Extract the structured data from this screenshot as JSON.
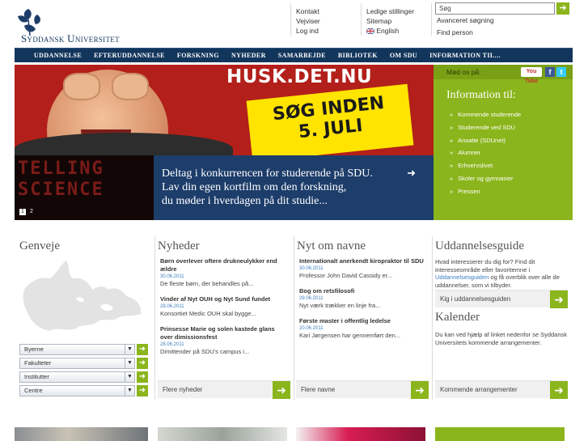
{
  "brand": {
    "name": "Syddansk Universitet"
  },
  "header": {
    "col1": [
      "Kontakt",
      "Vejviser",
      "Log ind"
    ],
    "col2": [
      "Ledige stillinger",
      "Sitemap",
      "English"
    ],
    "search_placeholder": "Søg",
    "advanced_search": "Avanceret søgning",
    "find_person": "Find person"
  },
  "nav": [
    "UDDANNELSE",
    "EFTERUDDANNELSE",
    "FORSKNING",
    "NYHEDER",
    "SAMARBEJDE",
    "BIBLIOTEK",
    "OM SDU",
    "INFORMATION TIL..."
  ],
  "hero": {
    "title": "HUSK.DET.NU",
    "sticker_line1": "SØG INDEN",
    "sticker_line2": "5. JULI",
    "sub_image_text": "TELLING SCIENCE",
    "pager": [
      "1",
      "2"
    ],
    "sub_line1": "Deltag i konkurrencen for studerende på SDU.",
    "sub_line2": "Lav din egen kortfilm om den forskning,",
    "sub_line3": "du møder i hverdagen på dit studie..."
  },
  "side": {
    "meet_label": "Mød os på:",
    "youtube": "You Tube",
    "heading": "Information til:",
    "items": [
      "Kommende studerende",
      "Studerende ved SDU",
      "Ansatte (SDUnet)",
      "Alumner",
      "Erhvervslivet",
      "Skoler og gymnasier",
      "Pressen"
    ]
  },
  "genveje": {
    "title": "Genveje",
    "dropdowns": [
      "Byerne",
      "Fakulteter",
      "Institutter",
      "Centre"
    ]
  },
  "nyheder": {
    "title": "Nyheder",
    "items": [
      {
        "title": "Børn overlever oftere drukneulykker end ældre",
        "date": "30.06.2011",
        "text": "De fleste børn, der behandles på..."
      },
      {
        "title": "Vinder af Nyt OUH og Nyt Sund fundet",
        "date": "28.06.2011",
        "text": "Konsortiet Medic OUH skal bygge..."
      },
      {
        "title": "Prinsesse Marie og solen kastede glans over dimissionsfest",
        "date": "28.06.2011",
        "text": "Dimittender på SDU's campus i..."
      }
    ],
    "more": "Flere nyheder"
  },
  "navne": {
    "title": "Nyt om navne",
    "items": [
      {
        "title": "Internationalt anerkendt kiropraktor til SDU",
        "date": "30.06.2011",
        "text": "Professor John David Cassidy er..."
      },
      {
        "title": "Bog om retsfilosofi",
        "date": "29.06.2011",
        "text": "Nyt værk trækker en linje fra..."
      },
      {
        "title": "Første master i offentlig ledelse",
        "date": "20.06.2011",
        "text": "Kari Jørgensen har gennemført den..."
      }
    ],
    "more": "Flere navne"
  },
  "uddannelsesguide": {
    "title": "Uddannelsesguide",
    "text1": "Hvad interesserer du dig for? Find dit interesseområde eller favoritemne",
    "text2_prefix": "i ",
    "text2_link": "Uddannelsesguiden",
    "text2_suffix": " og få overblik over alle de uddannelser, som vi tilbyder.",
    "field": "Kig i uddannelsesguiden"
  },
  "kalender": {
    "title": "Kalender",
    "text": "Du kan ved hjælp af linket nedenfor se Syddansk Universitets kommende arrangementer.",
    "more": "Kommende arrangementer"
  },
  "colors": {
    "navy": "#12355b",
    "green": "#8bb51c",
    "red": "#b31f1a",
    "yellow": "#ffe400",
    "link_blue": "#3b7fc0"
  }
}
